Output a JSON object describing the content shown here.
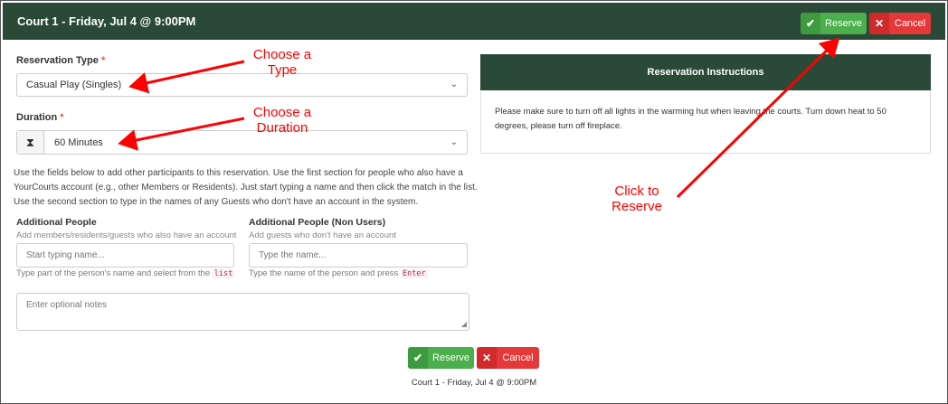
{
  "header": {
    "title": "Court 1 - Friday, Jul 4 @ 9:00PM",
    "reserve_label": "Reserve",
    "cancel_label": "Cancel"
  },
  "icons": {
    "check": "check-icon",
    "close": "close-icon",
    "hourglass": "hourglass-icon",
    "chevron": "chevron-down-icon"
  },
  "form": {
    "reservation_type_label": "Reservation Type",
    "reservation_type_value": "Casual Play (Singles)",
    "duration_label": "Duration",
    "duration_value": "60 Minutes",
    "required_marker": "*",
    "help_text": [
      "Use the fields below to add other participants to this reservation. Use the first section for people who also have a",
      "YourCourts account (e.g., other Members or Residents). Just start typing a name and then click the match in the list.",
      "Use the second section to type in the names of any Guests who don't have an account in the system."
    ],
    "additional_people": {
      "label": "Additional People",
      "sublabel": "Add members/residents/guests who also have an account",
      "placeholder": "Start typing name...",
      "hint_prefix": "Type part of the person's name and select from the",
      "hint_code": "list"
    },
    "additional_people_non_users": {
      "label": "Additional People (Non Users)",
      "sublabel": "Add guests who don't have an account",
      "placeholder": "Type the name...",
      "hint_prefix": "Type the name of the person and press",
      "hint_code": "Enter"
    },
    "notes_placeholder": "Enter optional notes"
  },
  "instructions": {
    "title": "Reservation Instructions",
    "body": "Please make sure to turn off all lights in the warming hut when leaving the courts. Turn down heat to 50 degrees, please turn off fireplace."
  },
  "footer": {
    "reserve_label": "Reserve",
    "cancel_label": "Cancel",
    "title": "Court 1 - Friday, Jul 4 @ 9:00PM"
  },
  "annotations": {
    "type": [
      "Choose a",
      "Type"
    ],
    "duration": [
      "Choose a",
      "Duration"
    ],
    "reserve": [
      "Click to",
      "Reserve"
    ]
  },
  "colors": {
    "header_bg": "#2a4a37",
    "reserve_green": "#4cae4c",
    "cancel_red": "#e4383a",
    "annotation_red": "#ff0000"
  }
}
